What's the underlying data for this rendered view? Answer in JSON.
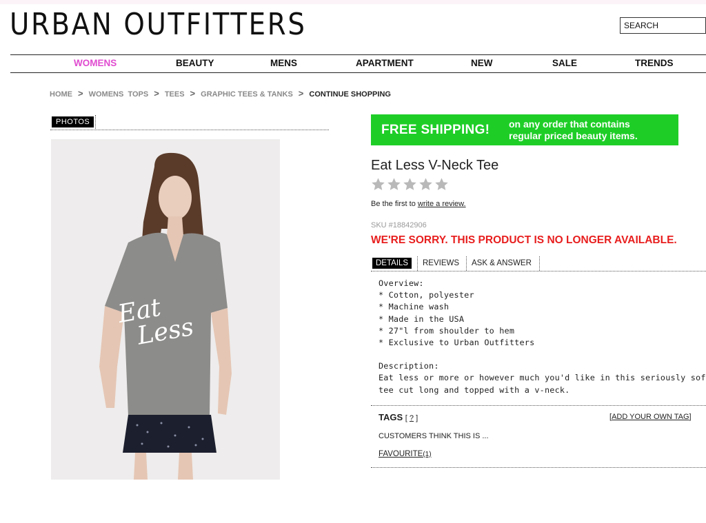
{
  "brand": {
    "logo_text": "URBAN OUTFITTERS"
  },
  "search": {
    "placeholder": "SEARCH"
  },
  "nav": {
    "items": [
      {
        "label": "WOMENS",
        "active": true
      },
      {
        "label": "BEAUTY"
      },
      {
        "label": "MENS"
      },
      {
        "label": "APARTMENT"
      },
      {
        "label": "NEW"
      },
      {
        "label": "SALE"
      },
      {
        "label": "TRENDS"
      }
    ]
  },
  "breadcrumb": {
    "home": "HOME",
    "womens": "WOMENS",
    "tops": "TOPS",
    "tees": "TEES",
    "graphic": "GRAPHIC TEES & TANKS",
    "current": "CONTINUE SHOPPING",
    "separator": ">"
  },
  "photos": {
    "tab_label": "PHOTOS",
    "shirt_text_line1": "Eat",
    "shirt_text_line2": "Less"
  },
  "shipping": {
    "headline": "FREE SHIPPING!",
    "line1": "on any order that contains",
    "line2": "regular priced beauty items.",
    "color": "#1ece27"
  },
  "product": {
    "title": "Eat Less V-Neck Tee",
    "rating": 0,
    "rating_max": 5,
    "review_prefix": "Be the first to",
    "review_link": "write a review.",
    "sku": "SKU #18842906",
    "unavailable": "WE'RE SORRY. THIS PRODUCT IS NO LONGER AVAILABLE.",
    "unavailable_color": "#e81e1e"
  },
  "tabs": {
    "details": "DETAILS",
    "reviews": "REVIEWS",
    "ask": "ASK & ANSWER"
  },
  "details": {
    "overview_heading": "Overview:",
    "bullets": [
      "* Cotton, polyester",
      "* Machine wash",
      "* Made in the USA",
      "* 27\"l from shoulder to hem",
      "* Exclusive to Urban Outfitters"
    ],
    "description_heading": "Description:",
    "description_line1": "Eat less or more or however much you'd like in this seriously soft knit",
    "description_line2": "tee cut long and topped with a v-neck."
  },
  "tags": {
    "label": "TAGS",
    "help_open": "[",
    "help_link": "?",
    "help_close": "]",
    "add_open": "[",
    "add_link": "ADD YOUR OWN TAG",
    "add_close": "]",
    "customers_think": "CUSTOMERS THINK THIS IS ...",
    "items": [
      {
        "name": "FAVOURITE",
        "count": "(1)"
      }
    ]
  }
}
